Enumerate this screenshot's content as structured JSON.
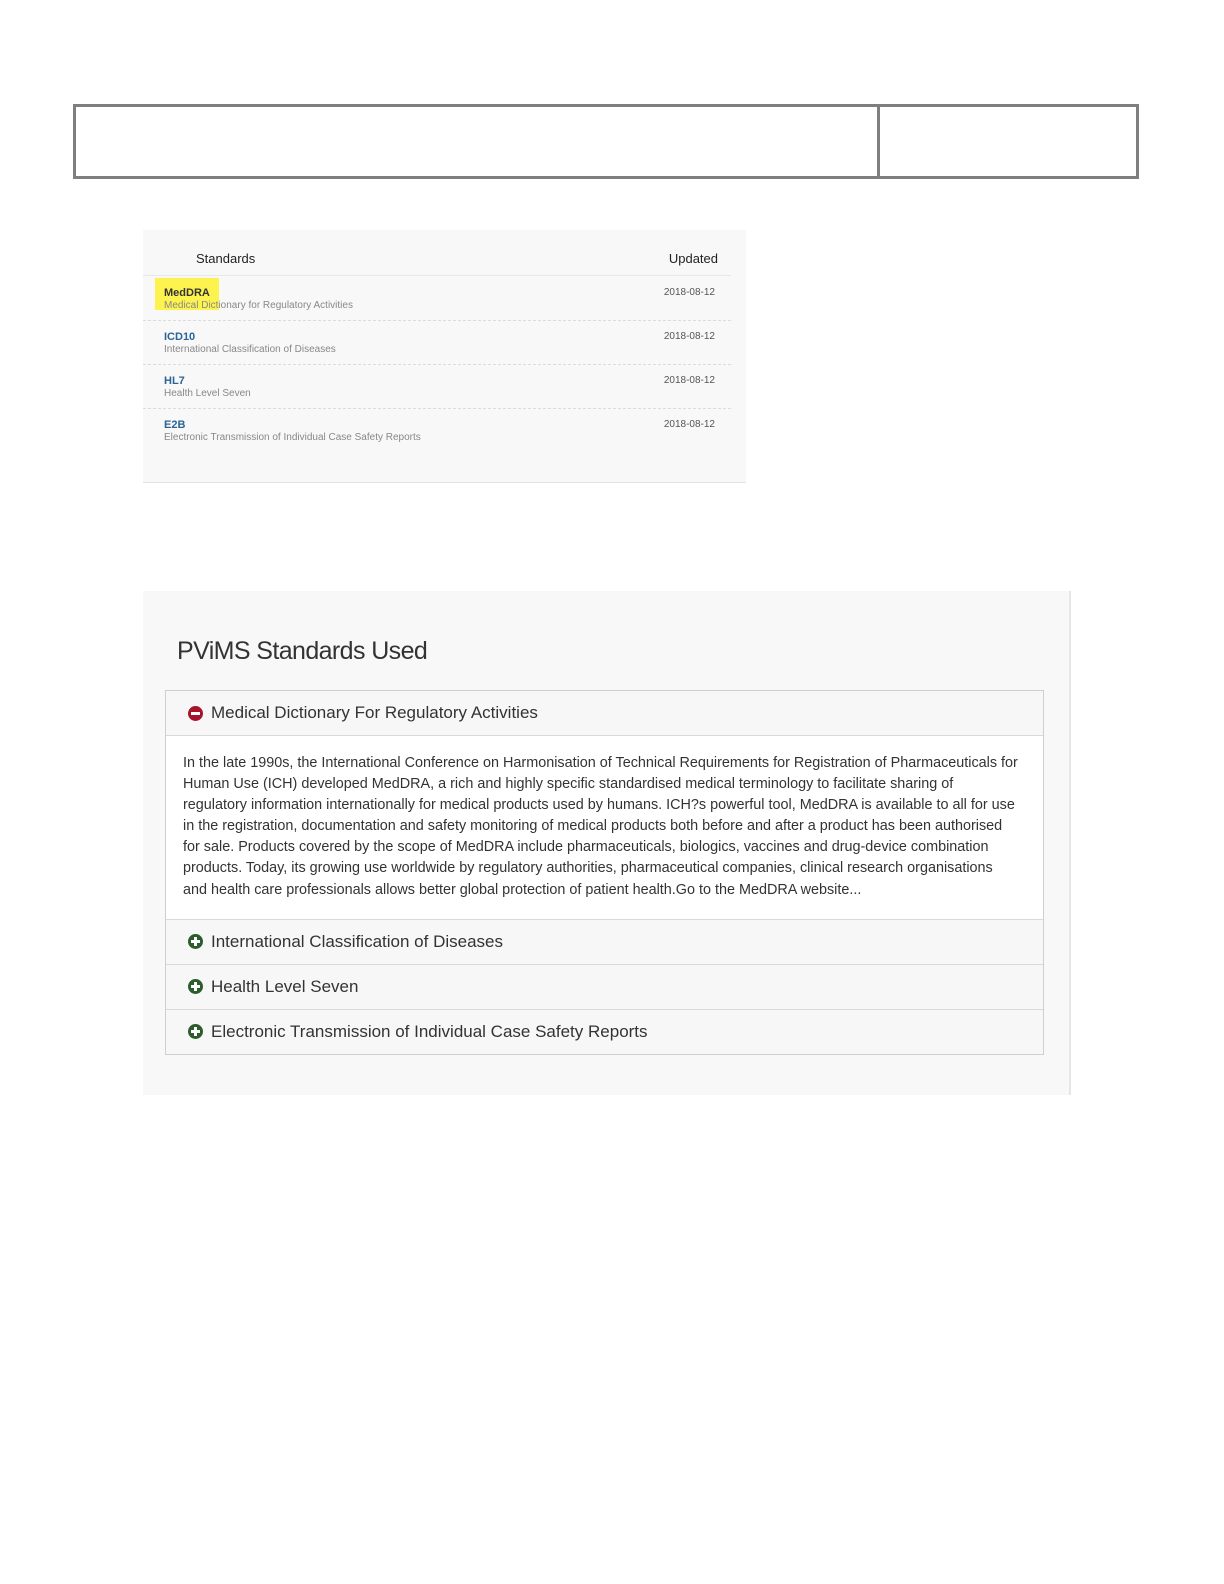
{
  "standards_list": {
    "header": {
      "standards": "Standards",
      "updated": "Updated"
    },
    "rows": [
      {
        "code": "MedDRA",
        "description": "Medical Dictionary for Regulatory Activities",
        "date": "2018-08-12"
      },
      {
        "code": "ICD10",
        "description": "International Classification of Diseases",
        "date": "2018-08-12"
      },
      {
        "code": "HL7",
        "description": "Health Level Seven",
        "date": "2018-08-12"
      },
      {
        "code": "E2B",
        "description": "Electronic Transmission of Individual Case Safety Reports",
        "date": "2018-08-12"
      }
    ]
  },
  "accordion": {
    "title": "PViMS Standards Used",
    "sections": [
      {
        "label": "Medical Dictionary For Regulatory Activities",
        "expanded": true,
        "body": "In the late 1990s, the International Conference on Harmonisation of Technical Requirements for Registration of Pharmaceuticals for Human Use (ICH) developed MedDRA, a rich and highly specific standardised medical terminology to facilitate sharing of regulatory information internationally for medical products used by humans. ICH?s powerful tool, MedDRA is available to all for use in the registration, documentation and safety monitoring of medical products both before and after a product has been authorised for sale. Products covered by the scope of MedDRA include pharmaceuticals, biologics, vaccines and drug-device combination products. Today, its growing use worldwide by regulatory authorities, pharmaceutical companies, clinical research organisations and health care professionals allows better global protection of patient health.Go to the MedDRA website..."
      },
      {
        "label": "International Classification of Diseases",
        "expanded": false
      },
      {
        "label": "Health Level Seven",
        "expanded": false
      },
      {
        "label": "Electronic Transmission of Individual Case Safety Reports",
        "expanded": false
      }
    ]
  },
  "colors": {
    "link": "#2a6496",
    "highlight": "#fdf23c",
    "collapse_icon": "#a5152b",
    "expand_icon": "#2c5d2c"
  }
}
